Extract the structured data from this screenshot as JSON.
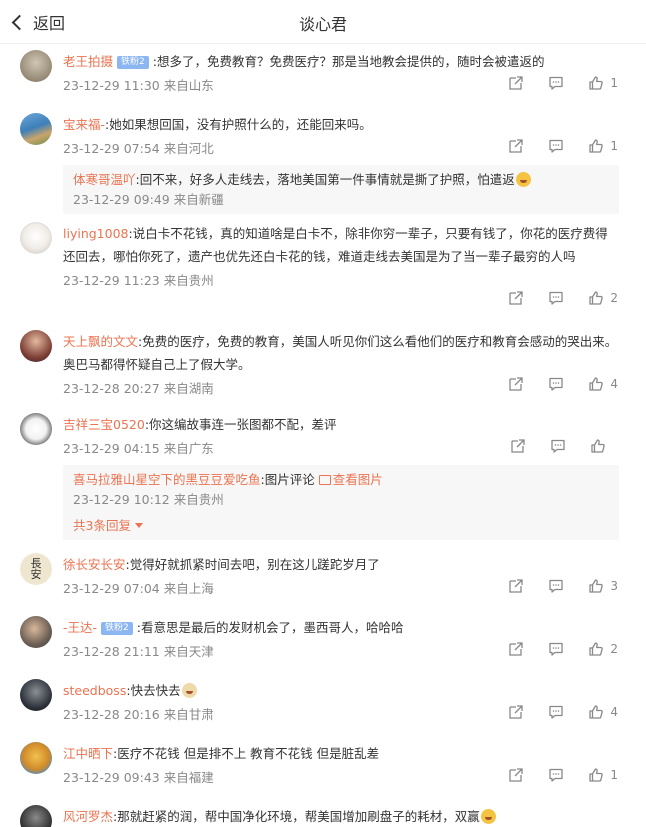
{
  "header": {
    "back_label": "返回",
    "title": "谈心君"
  },
  "colors": {
    "username": "#eb7350",
    "meta": "#888888",
    "badge": "#8cb6f2"
  },
  "icons": {
    "share": "share-icon",
    "comment": "comment-icon",
    "like": "like-icon",
    "back": "chevron-left-icon"
  },
  "comments": [
    {
      "user": "老王拍摄",
      "badge": "铁粉2",
      "text": "想多了，免费教育？免费医疗？那是当地教会提供的，随时会被遣返的",
      "meta": "23-12-29 11:30 来自山东",
      "likes": "1"
    },
    {
      "user": "宝来福-",
      "text": "她如果想回国，没有护照什么的，还能回来吗。",
      "meta": "23-12-29 07:54 来自河北",
      "likes": "1",
      "reply": {
        "user": "体寒哥温吖",
        "text": "回不来，好多人走线去，落地美国第一件事情就是撕了护照，怕遣返",
        "meta": "23-12-29 09:49 来自新疆"
      }
    },
    {
      "user": "liying1008",
      "text": "说白卡不花钱，真的知道啥是白卡不，除非你穷一辈子，只要有钱了，你花的医疗费得还回去，哪怕你死了，遗产也优先还白卡花的钱，难道走线去美国是为了当一辈子最穷的人吗",
      "meta": "23-12-29 11:23 来自贵州",
      "likes": "2"
    },
    {
      "user": "天上飘的文文",
      "text": "免费的医疗，免费的教育，美国人听见你们这么看他们的医疗和教育会感动的哭出来。奥巴马都得怀疑自己上了假大学。",
      "meta": "23-12-28 20:27 来自湖南",
      "likes": "4"
    },
    {
      "user": "吉祥三宝0520",
      "text": "你这编故事连一张图都不配，差评",
      "meta": "23-12-29 04:15 来自广东",
      "likes": "",
      "reply": {
        "user": "喜马拉雅山星空下的黑豆豆爱吃鱼",
        "text": "图片评论",
        "pic_link": "查看图片",
        "meta": "23-12-29 10:12 来自贵州"
      },
      "more": "共3条回复"
    },
    {
      "user": "徐长安长安",
      "text": "觉得好就抓紧时间去吧，别在这儿蹉跎岁月了",
      "meta": "23-12-29 07:04 来自上海",
      "likes": "3"
    },
    {
      "user": "-王达-",
      "badge": "铁粉2",
      "text": "看意思是最后的发财机会了，墨西哥人，哈哈哈",
      "meta": "23-12-28 21:11 来自天津",
      "likes": "2"
    },
    {
      "user": "steedboss",
      "text": "快去快去",
      "meta": "23-12-28 20:16 来自甘肃",
      "likes": "4"
    },
    {
      "user": "江中晒下",
      "text": "医疗不花钱 但是排不上  教育不花钱 但是脏乱差",
      "meta": "23-12-29 09:43 来自福建",
      "likes": "1"
    },
    {
      "user": "风河罗杰",
      "text": "那就赶紧的润，帮中国净化环境，帮美国增加刷盘子的耗材，双赢",
      "meta": "",
      "likes": ""
    }
  ]
}
